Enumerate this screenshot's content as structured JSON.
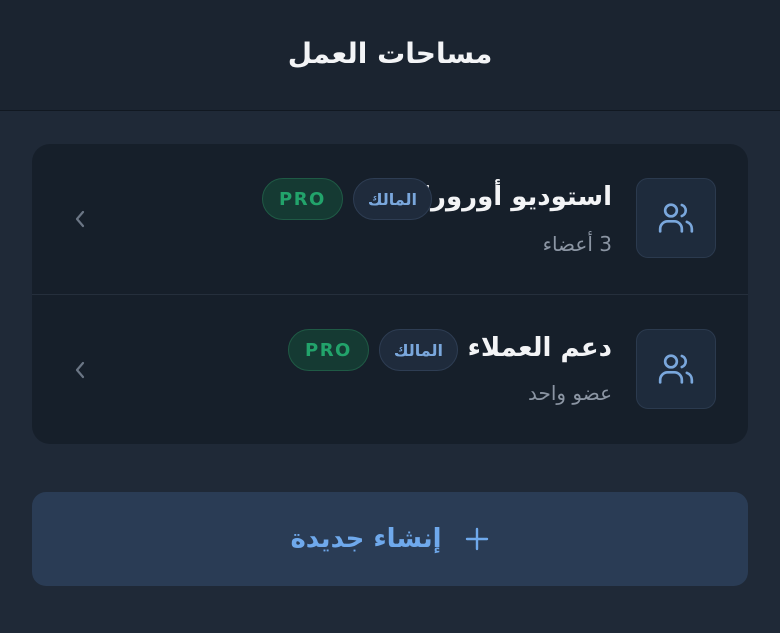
{
  "header": {
    "title": "مساحات العمل"
  },
  "workspaces": [
    {
      "name": "استوديو أورورا",
      "members": "3 أعضاء",
      "role_badge": "المالك",
      "plan_badge": "PRO",
      "icon": "users-icon"
    },
    {
      "name": "دعم العملاء",
      "members": "عضو واحد",
      "role_badge": "المالك",
      "plan_badge": "PRO",
      "icon": "users-icon"
    }
  ],
  "create_button": {
    "label": "إنشاء جديدة",
    "icon": "plus-icon"
  },
  "colors": {
    "background": "#1f2937",
    "card": "#161f2a",
    "accent_blue": "#6fa9ec",
    "pro_green": "#22a36b"
  }
}
